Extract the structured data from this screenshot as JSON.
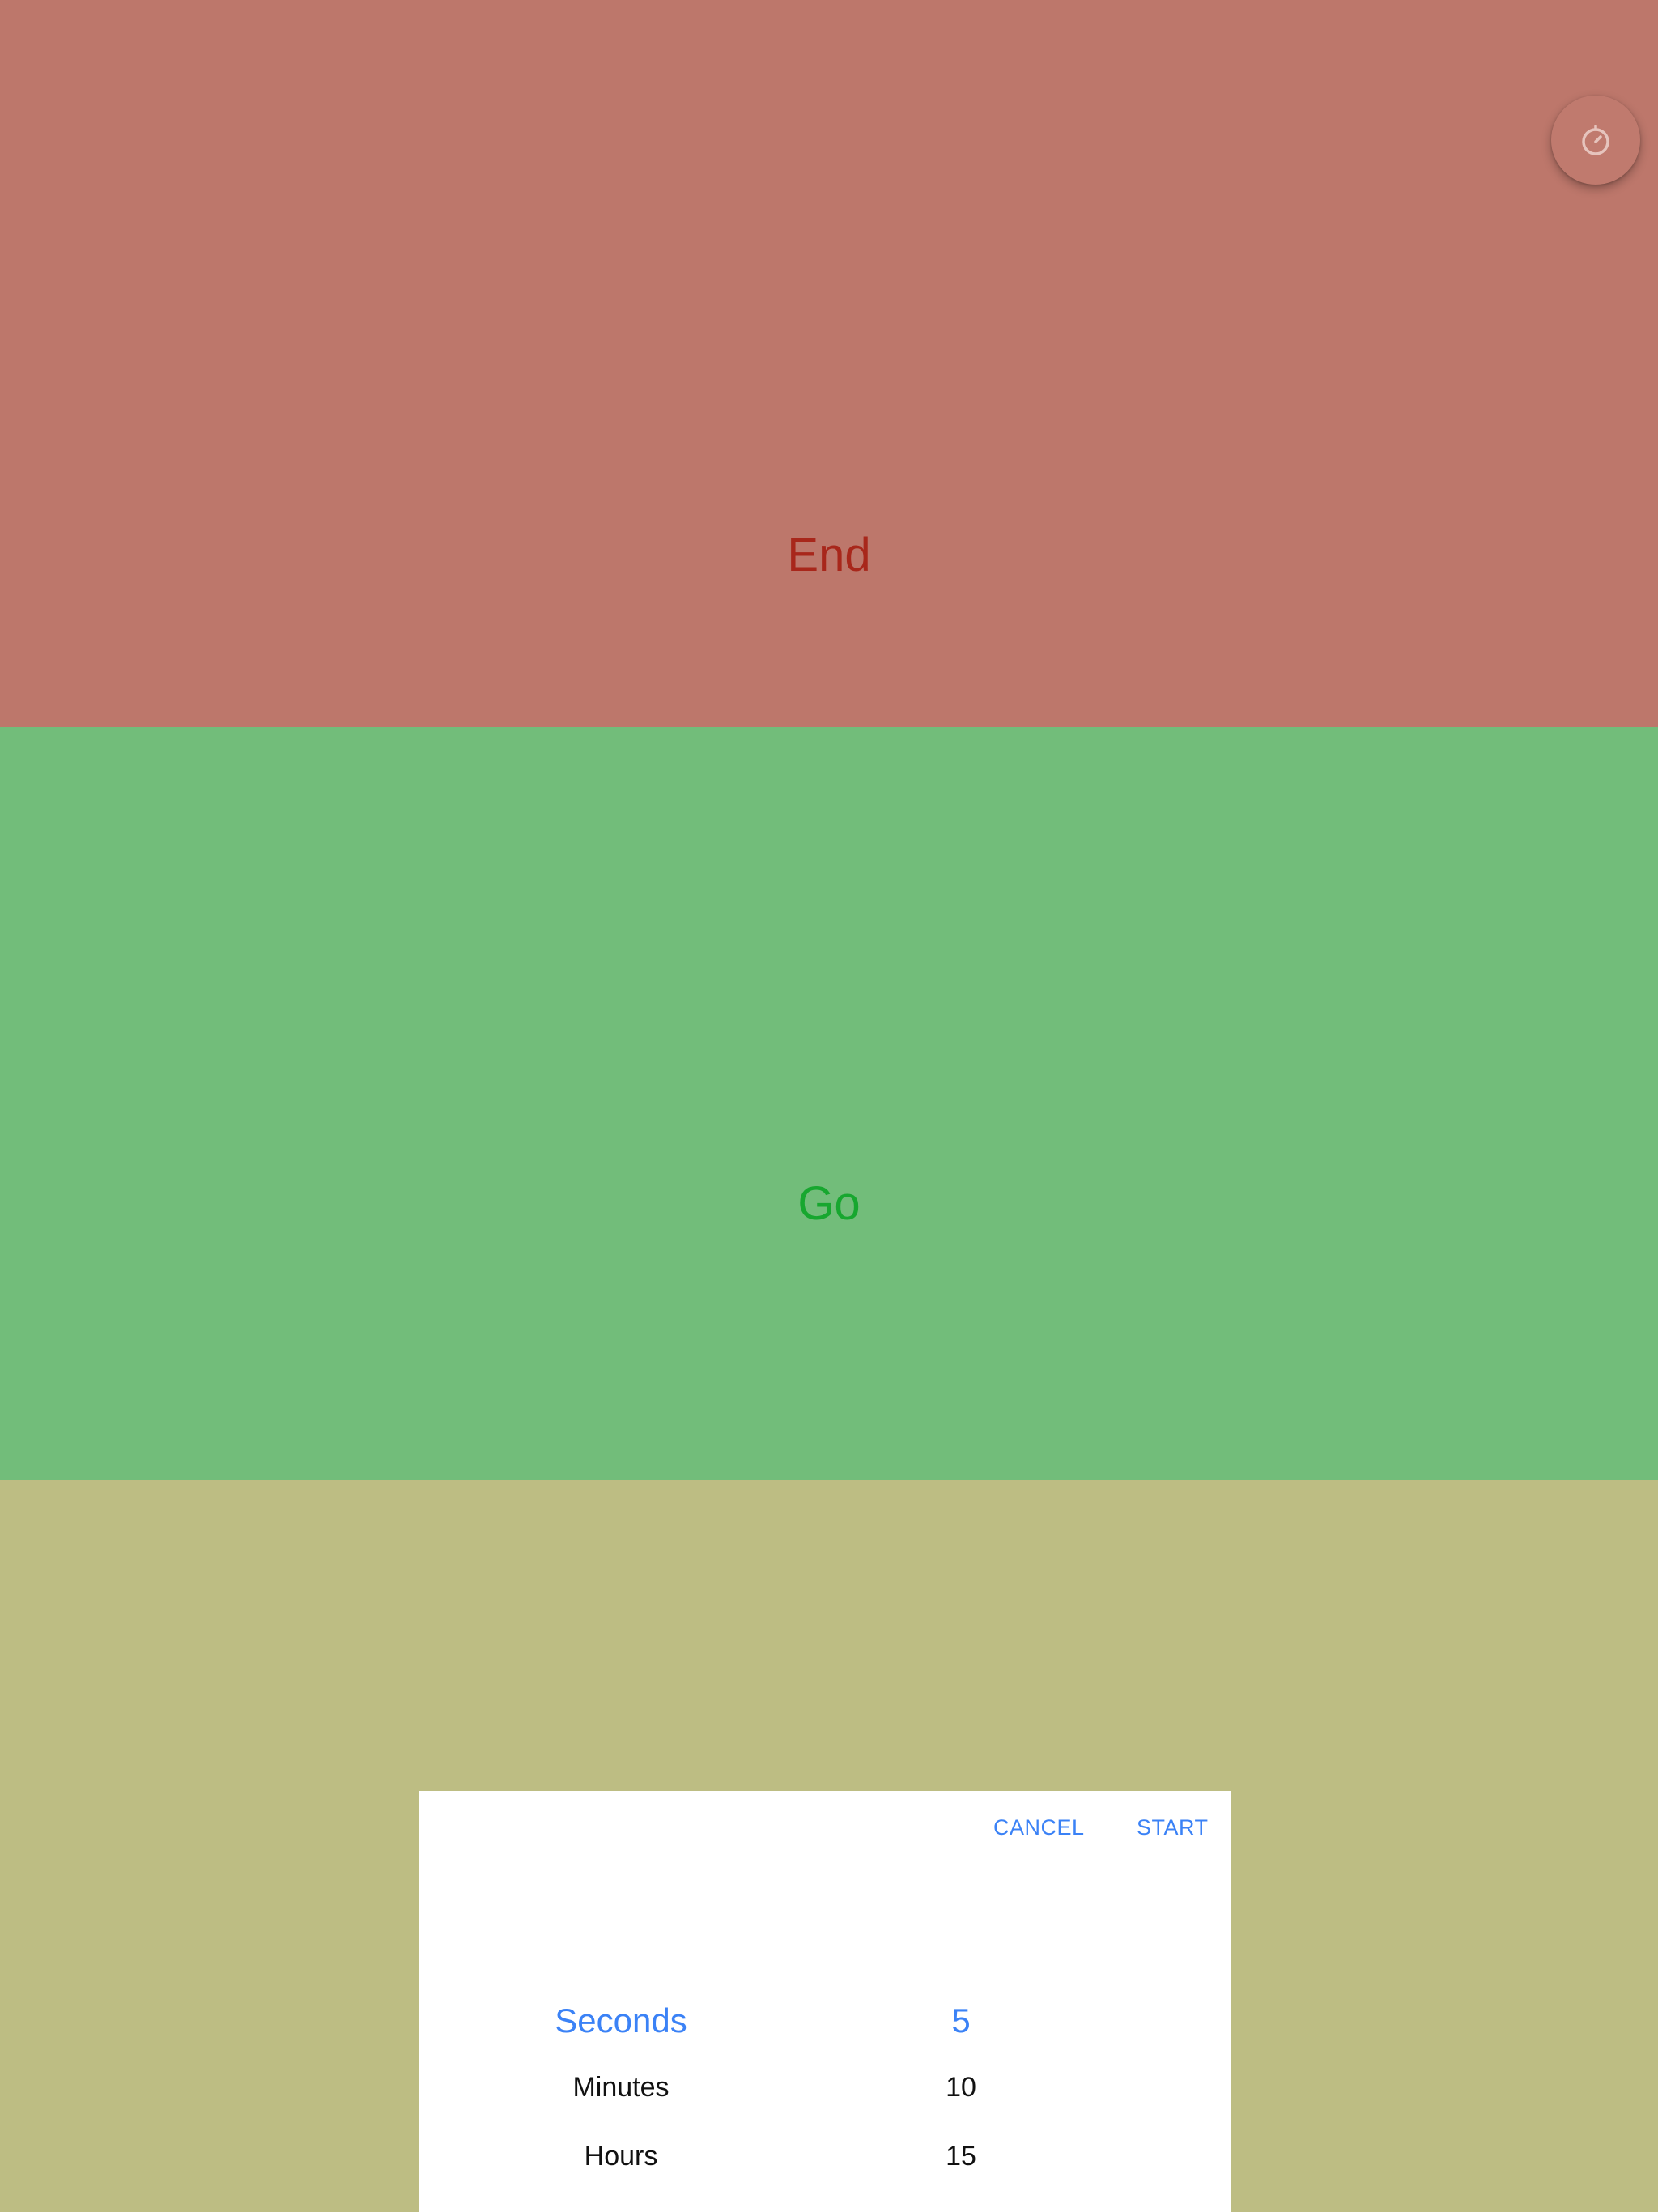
{
  "colors": {
    "end_bg": "#bd776b",
    "end_text": "#a8271b",
    "go_bg": "#72bd7a",
    "go_text": "#17a72f",
    "yellow_bg": "#bdbd83",
    "fab_bg": "#c07a6e",
    "fab_icon": "#e6c4bd",
    "picker_accent": "#3b82f6",
    "picker_text": "#111111"
  },
  "panels": {
    "end": {
      "label": "End"
    },
    "go": {
      "label": "Go"
    }
  },
  "fab": {
    "icon": "timer-icon"
  },
  "picker": {
    "cancel_label": "CANCEL",
    "start_label": "START",
    "rows": [
      {
        "unit": "Seconds",
        "value": "5",
        "selected": true
      },
      {
        "unit": "Minutes",
        "value": "10",
        "selected": false
      },
      {
        "unit": "Hours",
        "value": "15",
        "selected": false
      }
    ]
  }
}
